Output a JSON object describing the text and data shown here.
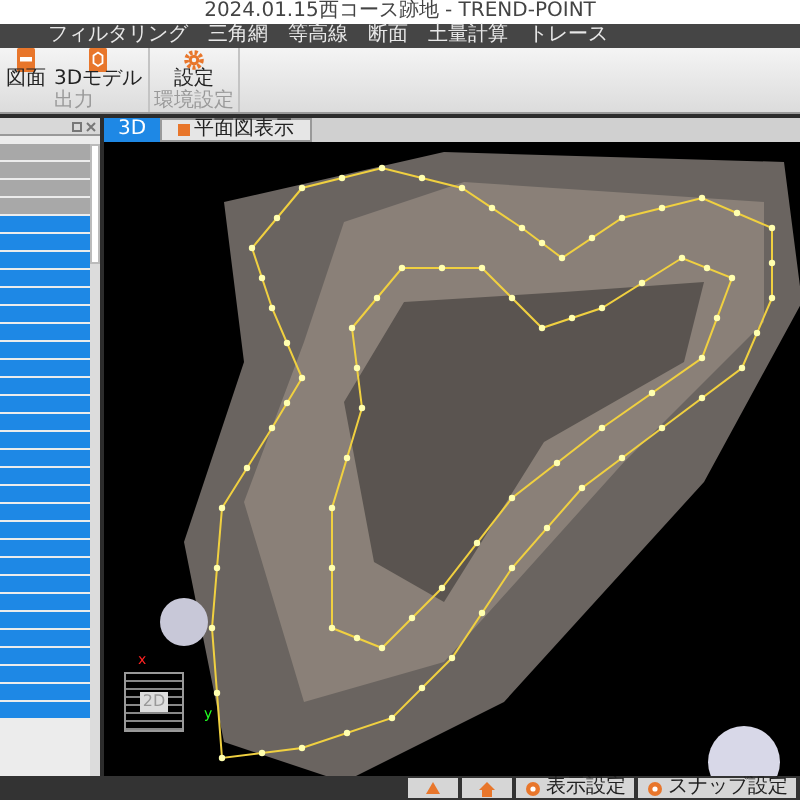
{
  "window": {
    "title": "2024.01.15西コース跡地 - TREND-POINT"
  },
  "menu": [
    "フィルタリング",
    "三角網",
    "等高線",
    "断面",
    "土量計算",
    "トレース"
  ],
  "ribbon_groups": [
    {
      "label": "出力",
      "buttons": [
        {
          "kind": "cad",
          "label": "図面"
        },
        {
          "kind": "model",
          "label": "3Dモデル"
        }
      ]
    },
    {
      "label": "環境設定",
      "buttons": [
        {
          "kind": "gear",
          "label": "設定"
        }
      ]
    }
  ],
  "view_tabs": [
    {
      "label": "3D",
      "selected": true,
      "kind": "plain"
    },
    {
      "label": "平面図表示",
      "selected": false,
      "kind": "icon"
    }
  ],
  "panel_rows": [
    {
      "selected": false
    },
    {
      "selected": false
    },
    {
      "selected": false
    },
    {
      "selected": false
    },
    {
      "selected": true
    },
    {
      "selected": true
    },
    {
      "selected": true
    },
    {
      "selected": true
    },
    {
      "selected": true
    },
    {
      "selected": true
    },
    {
      "selected": true
    },
    {
      "selected": true
    },
    {
      "selected": true
    },
    {
      "selected": true
    },
    {
      "selected": true
    },
    {
      "selected": true
    },
    {
      "selected": true
    },
    {
      "selected": true
    },
    {
      "selected": true
    },
    {
      "selected": true
    },
    {
      "selected": true
    },
    {
      "selected": true
    },
    {
      "selected": true
    },
    {
      "selected": true
    },
    {
      "selected": true
    },
    {
      "selected": true
    },
    {
      "selected": true
    },
    {
      "selected": true
    },
    {
      "selected": true
    },
    {
      "selected": true
    },
    {
      "selected": true
    },
    {
      "selected": true
    }
  ],
  "gizmo": {
    "label": "2D",
    "x_axis": "x",
    "y_axis": "y"
  },
  "status_bar": {
    "buttons": [
      {
        "kind": "icon-up"
      },
      {
        "kind": "icon-home"
      },
      {
        "kind": "text",
        "label": "表示設定"
      },
      {
        "kind": "text",
        "label": "スナップ設定"
      }
    ]
  }
}
